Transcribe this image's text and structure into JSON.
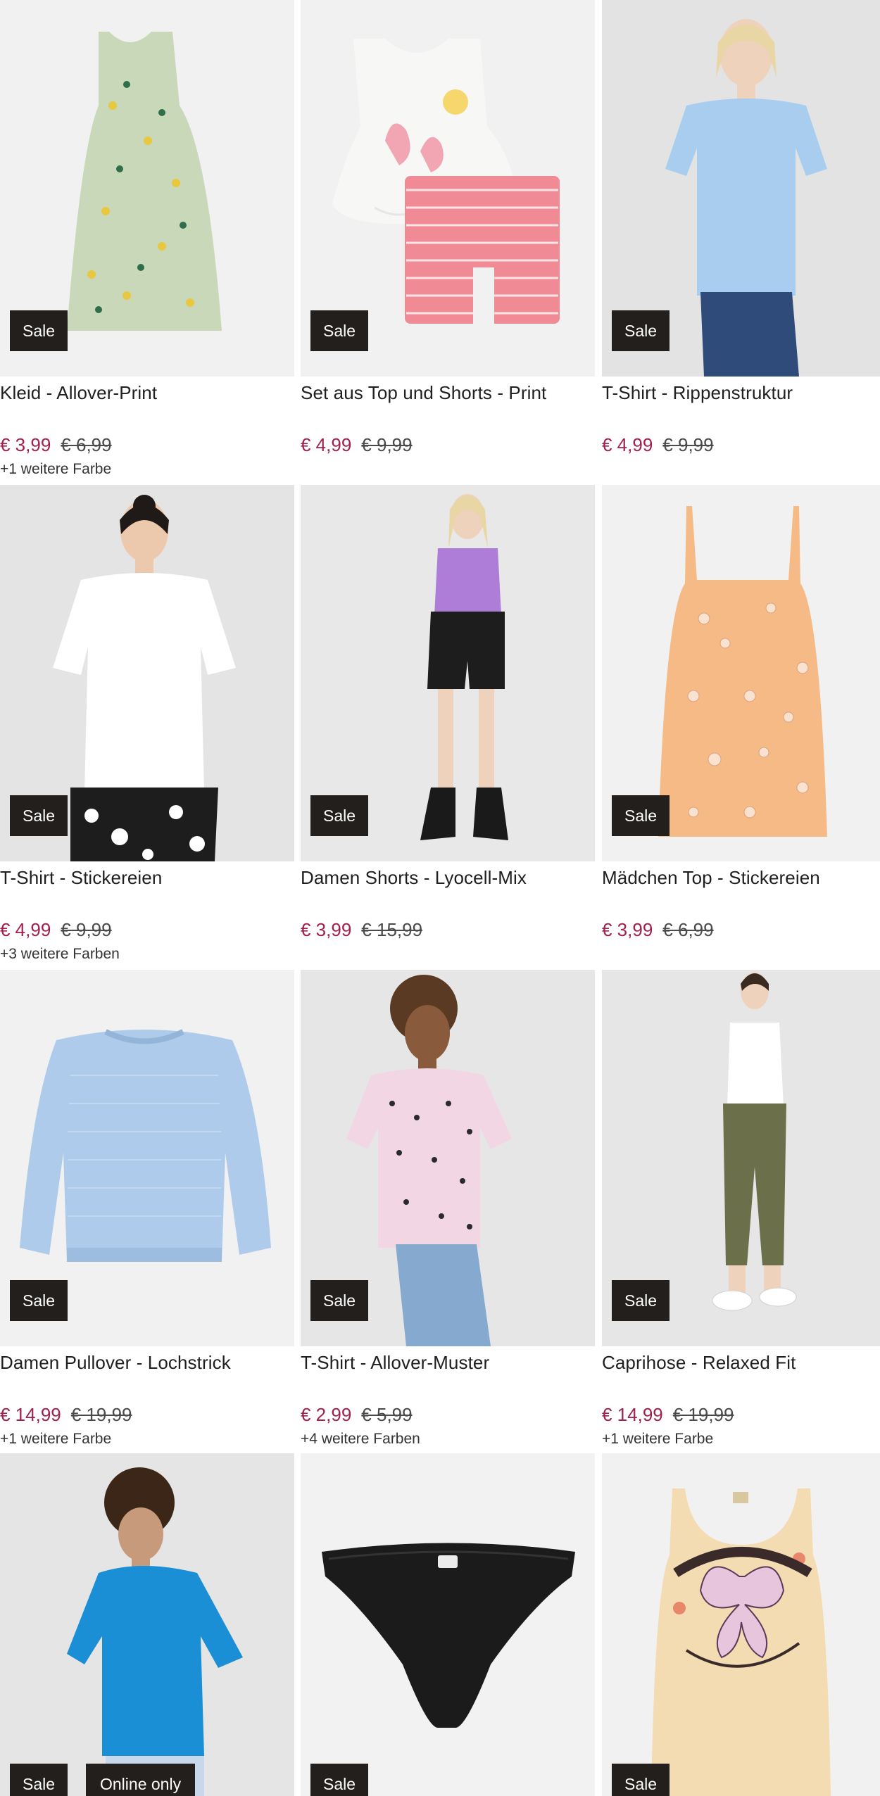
{
  "products": [
    {
      "title": "Kleid - Allover-Print",
      "price": "€ 3,99",
      "old_price": "€ 6,99",
      "colors": "+1 weitere Farbe",
      "badges": [
        "Sale"
      ],
      "image": "dress-mint-icon"
    },
    {
      "title": "Set aus Top und Shorts - Print",
      "price": "€ 4,99",
      "old_price": "€ 9,99",
      "colors": "",
      "badges": [
        "Sale"
      ],
      "image": "flamingo-set-icon"
    },
    {
      "title": "T-Shirt - Rippenstruktur",
      "price": "€ 4,99",
      "old_price": "€ 9,99",
      "colors": "",
      "badges": [
        "Sale"
      ],
      "image": "model-blue-tshirt-icon"
    },
    {
      "title": "T-Shirt - Stickereien",
      "price": "€ 4,99",
      "old_price": "€ 9,99",
      "colors": "+3 weitere Farben",
      "badges": [
        "Sale"
      ],
      "image": "model-white-tshirt-icon"
    },
    {
      "title": "Damen Shorts - Lyocell-Mix",
      "price": "€ 3,99",
      "old_price": "€ 15,99",
      "colors": "",
      "badges": [
        "Sale"
      ],
      "image": "model-black-shorts-icon"
    },
    {
      "title": "Mädchen Top - Stickereien",
      "price": "€ 3,99",
      "old_price": "€ 6,99",
      "colors": "",
      "badges": [
        "Sale"
      ],
      "image": "orange-top-icon"
    },
    {
      "title": "Damen Pullover - Lochstrick",
      "price": "€ 14,99",
      "old_price": "€ 19,99",
      "colors": "+1 weitere Farbe",
      "badges": [
        "Sale"
      ],
      "image": "blue-sweater-icon"
    },
    {
      "title": "T-Shirt - Allover-Muster",
      "price": "€ 2,99",
      "old_price": "€ 5,99",
      "colors": "+4 weitere Farben",
      "badges": [
        "Sale"
      ],
      "image": "model-pink-tshirt-icon"
    },
    {
      "title": "Caprihose - Relaxed Fit",
      "price": "€ 14,99",
      "old_price": "€ 19,99",
      "colors": "+1 weitere Farbe",
      "badges": [
        "Sale"
      ],
      "image": "model-caprihose-icon"
    },
    {
      "title": "",
      "price": "",
      "old_price": "",
      "colors": "",
      "badges": [
        "Sale",
        "Online only"
      ],
      "image": "model-blue-tshirt-icon"
    },
    {
      "title": "",
      "price": "",
      "old_price": "",
      "colors": "",
      "badges": [
        "Sale"
      ],
      "image": "black-brief-icon"
    },
    {
      "title": "",
      "price": "",
      "old_price": "",
      "colors": "",
      "badges": [
        "Sale"
      ],
      "image": "happy-tank-top-icon"
    }
  ],
  "palette": {
    "price": "#a3204e",
    "badge_bg": "#231f1c",
    "image_bg": "#f0f0f0"
  }
}
